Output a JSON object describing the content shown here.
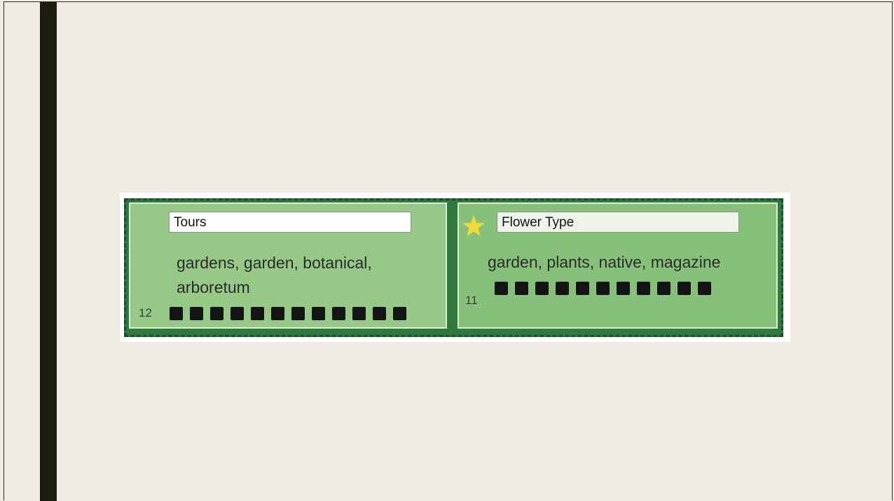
{
  "clusters": [
    {
      "name": "Tours",
      "keywords_line1": "gardens, garden, botanical,",
      "keywords_line2": "arboretum",
      "count": "12",
      "square_count": 12,
      "starred": false
    },
    {
      "name": "Flower Type",
      "keywords_line1": "garden, plants,  native, magazine",
      "count": "11",
      "square_count": 11,
      "starred": true
    }
  ],
  "colors": {
    "star": "#f2d93a",
    "square": "#141414"
  }
}
